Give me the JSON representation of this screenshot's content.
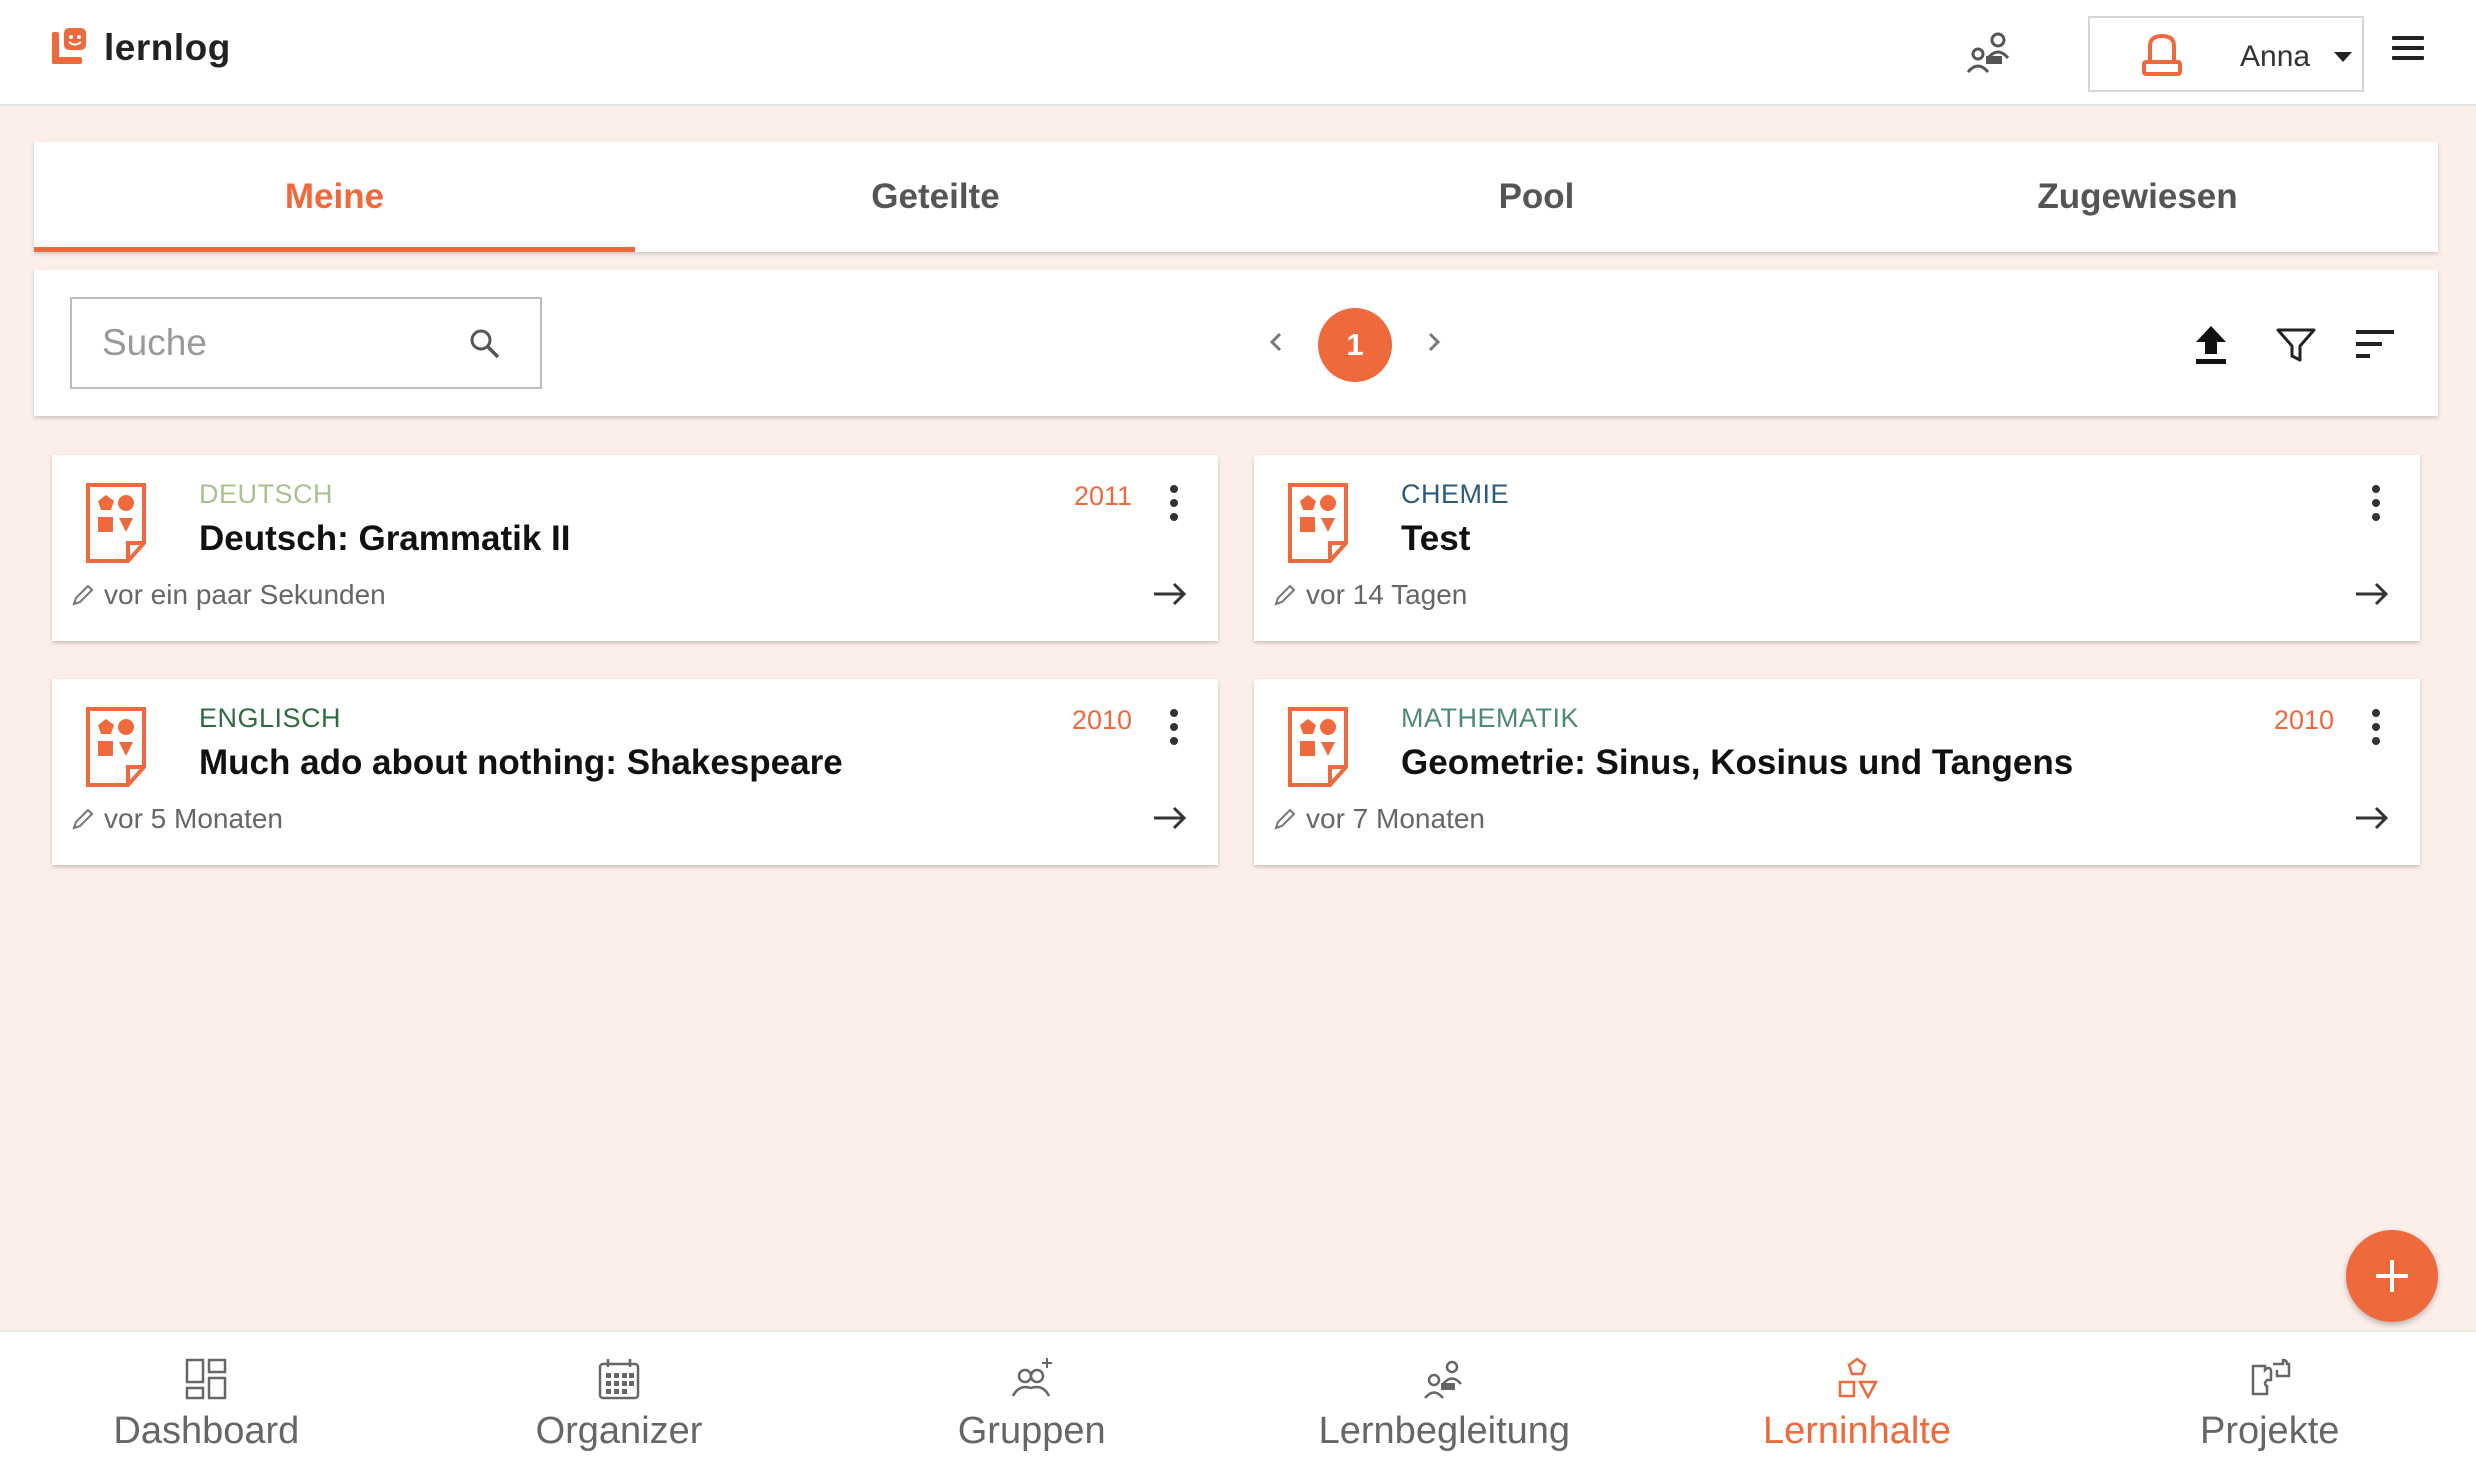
{
  "header": {
    "app_name": "lernlog",
    "user_name": "Anna"
  },
  "tabs": [
    {
      "label": "Meine",
      "active": true
    },
    {
      "label": "Geteilte",
      "active": false
    },
    {
      "label": "Pool",
      "active": false
    },
    {
      "label": "Zugewiesen",
      "active": false
    }
  ],
  "toolbar": {
    "search_placeholder": "Suche",
    "current_page": "1"
  },
  "cards": [
    {
      "subject": "DEUTSCH",
      "subject_color": "#a9c08f",
      "title": "Deutsch: Grammatik II",
      "year": "2011",
      "edited": "vor ein paar Sekunden"
    },
    {
      "subject": "CHEMIE",
      "subject_color": "#2c5a78",
      "title": "Test",
      "year": "",
      "edited": "vor 14 Tagen"
    },
    {
      "subject": "ENGLISCH",
      "subject_color": "#2f6b3f",
      "title": "Much ado about nothing: Shakespeare",
      "year": "2010",
      "edited": "vor 5 Monaten"
    },
    {
      "subject": "MATHEMATIK",
      "subject_color": "#4f8a72",
      "title": "Geometrie: Sinus, Kosinus und Tangens",
      "year": "2010",
      "edited": "vor 7 Monaten"
    }
  ],
  "bottom_nav": [
    {
      "label": "Dashboard",
      "icon": "dashboard-icon",
      "active": false
    },
    {
      "label": "Organizer",
      "icon": "calendar-icon",
      "active": false
    },
    {
      "label": "Gruppen",
      "icon": "groups-icon",
      "active": false
    },
    {
      "label": "Lernbegleitung",
      "icon": "mentoring-icon",
      "active": false
    },
    {
      "label": "Lerninhalte",
      "icon": "shapes-icon",
      "active": true
    },
    {
      "label": "Projekte",
      "icon": "puzzle-icon",
      "active": false
    }
  ],
  "colors": {
    "accent": "#ee6a3c",
    "background": "#fcefea"
  }
}
